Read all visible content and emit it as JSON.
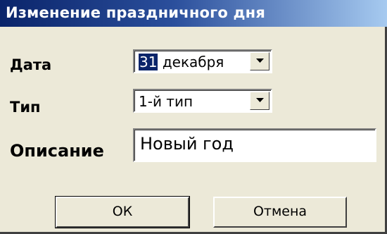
{
  "window": {
    "title": "Изменение праздничного дня"
  },
  "fields": {
    "date_label": "Дата",
    "date_day": "31",
    "date_month": "декабря",
    "type_label": "Тип",
    "type_value": "1-й тип",
    "description_label": "Описание",
    "description_value": "Новый год"
  },
  "buttons": {
    "ok_label": "ОК",
    "cancel_label": "Отмена"
  },
  "icons": {
    "dropdown": "chevron-down-icon"
  },
  "colors": {
    "title_bar_start": "#0a246a",
    "title_bar_end": "#a6caf0",
    "face": "#ece9d8",
    "selection": "#0a246a"
  }
}
